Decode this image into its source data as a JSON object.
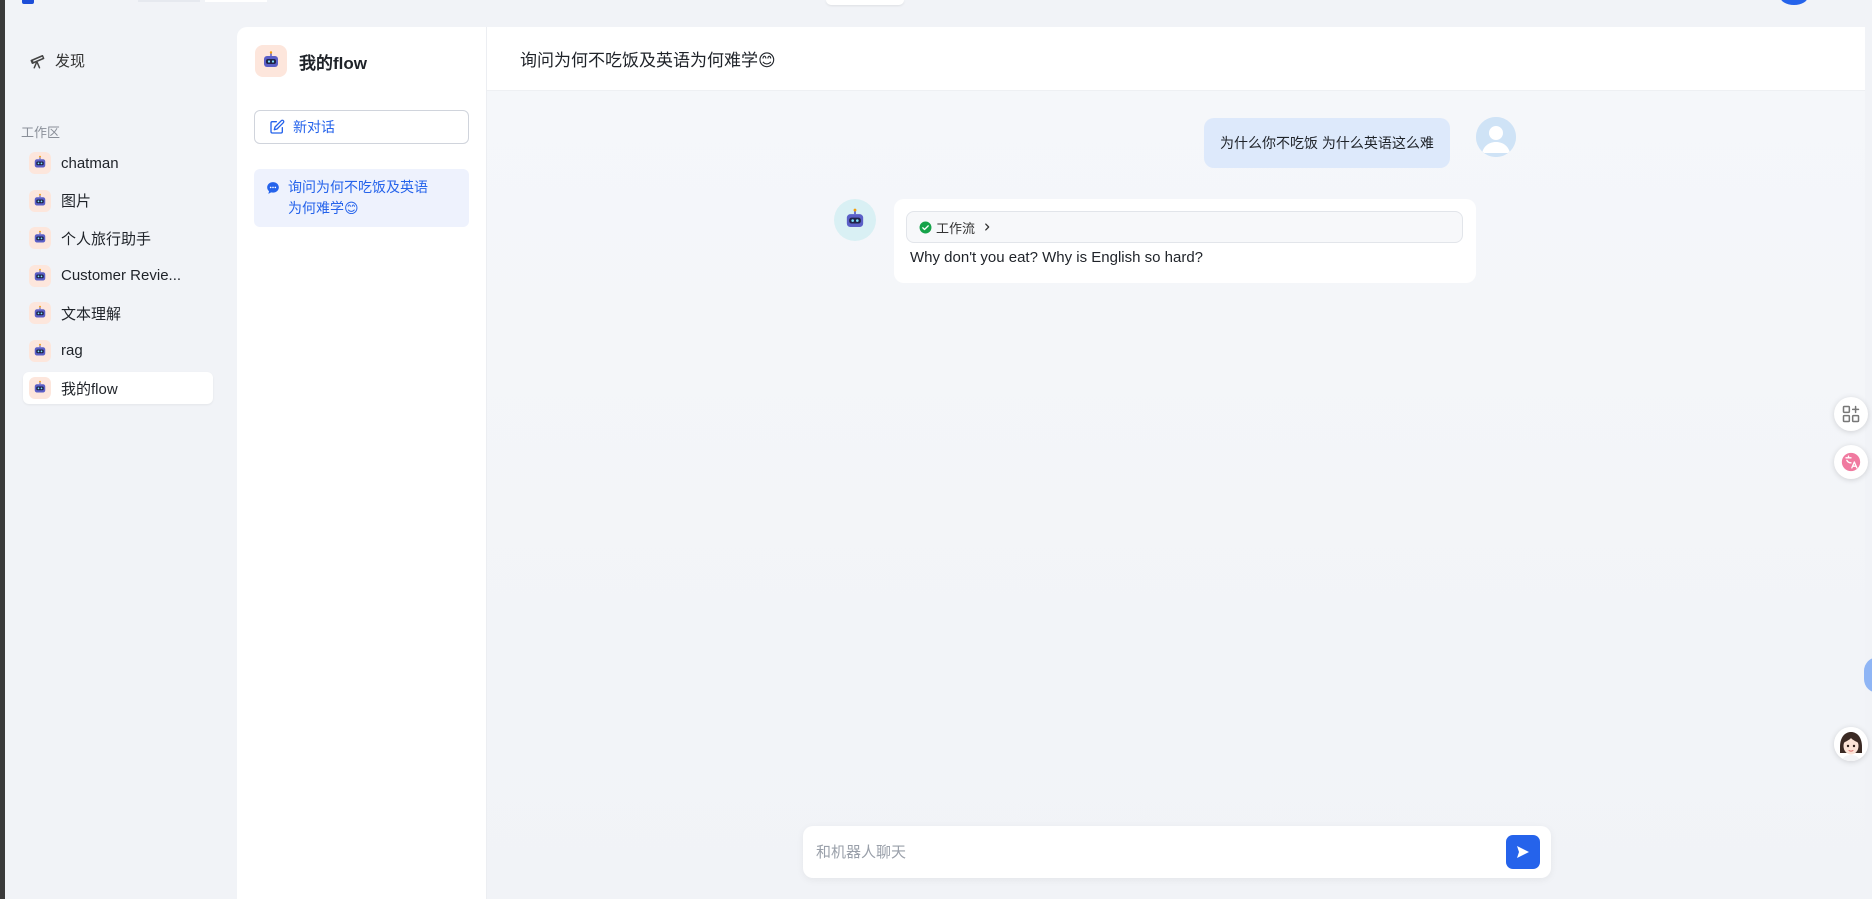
{
  "nav": {
    "discover_label": "发现",
    "workspace_label": "工作区"
  },
  "apps": [
    {
      "label": "chatman"
    },
    {
      "label": "图片"
    },
    {
      "label": "个人旅行助手"
    },
    {
      "label": "Customer Revie..."
    },
    {
      "label": "文本理解"
    },
    {
      "label": "rag"
    },
    {
      "label": "我的flow",
      "active": true
    }
  ],
  "conversation_panel": {
    "app_title": "我的flow",
    "new_chat_label": "新对话",
    "items": [
      {
        "title": "询问为何不吃饭及英语为何难学😊"
      }
    ]
  },
  "chat": {
    "title": "询问为何不吃饭及英语为何难学😊",
    "messages": [
      {
        "role": "user",
        "text": "为什么你不吃饭 为什么英语这么难"
      },
      {
        "role": "bot",
        "workflow_label": "工作流",
        "text": "Why don't you eat? Why is English so hard?"
      }
    ],
    "input_placeholder": "和机器人聊天"
  },
  "colors": {
    "accent": "#2563eb",
    "user_bubble": "#dde9fb",
    "active_conversation": "#eef2fd",
    "success": "#16a34a"
  },
  "icons": {
    "discover": "telescope-icon",
    "new_chat": "edit-icon",
    "conversation": "chat-bubble-icon",
    "send": "send-icon",
    "workflow_status": "check-circle-icon",
    "float_apps": "app-grid-icon",
    "float_translate": "translate-icon",
    "float_assistant": "assistant-avatar-icon"
  }
}
